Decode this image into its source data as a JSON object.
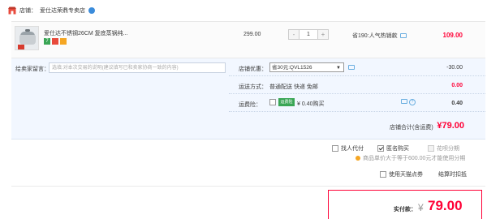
{
  "shop": {
    "label": "店铺：",
    "name": "爱仕达荣鼎专卖店"
  },
  "item": {
    "title": "爱仕达不锈钢26CM 复底蒸锅纯...",
    "badge_1": "7",
    "price": "299.00",
    "quantity": "1",
    "minus": "-",
    "plus": "+",
    "promo": "省190:人气热销款",
    "subtotal": "109.00"
  },
  "message": {
    "label": "给卖家留言：",
    "placeholder": "选填:对本次交易的说明(建议填写已和卖家协商一致的内容)"
  },
  "options": {
    "coupon_label": "店铺优惠：",
    "coupon_value": "省30元:QVL1526",
    "coupon_amount": "-30.00",
    "delivery_label": "运送方式：",
    "delivery_text": "普通配送 快递 免邮",
    "delivery_amount": "0.00",
    "insurance_label": "运费险：",
    "insurance_badge": "运费险",
    "insurance_text": "¥ 0.40购买",
    "insurance_amount": "0.40",
    "help": "?"
  },
  "shop_total": {
    "label": "店铺合计(含运费)",
    "value": "¥79.00"
  },
  "checkout_options": {
    "proxy_pay": "找人代付",
    "anonymous": "匿名购买",
    "installment": "花呗分期",
    "installment_note": "商品单价大于等于600.00元才能使用分期",
    "tmall_points": "使用天猫点券",
    "deduction": "结算时扣抵"
  },
  "payment": {
    "label": "实付款：",
    "currency": "¥",
    "value": "79.00"
  }
}
